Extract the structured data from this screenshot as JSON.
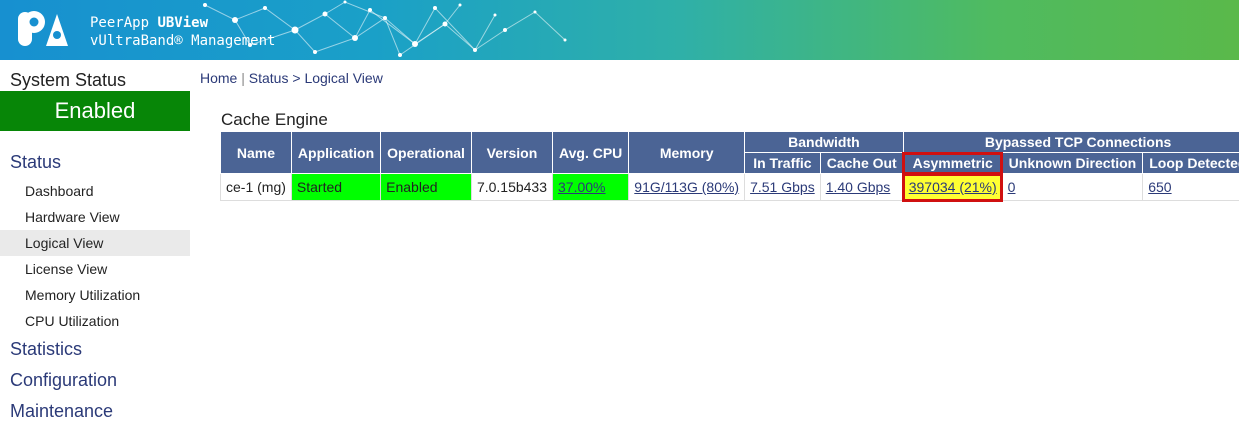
{
  "header": {
    "brand_line1_prefix": "PeerApp ",
    "brand_line1_bold": "UBView",
    "brand_line2": "vUltraBand® Management"
  },
  "sidebar": {
    "system_status_title": "System Status",
    "system_status_value": "Enabled",
    "status_heading": "Status",
    "status_items": [
      "Dashboard",
      "Hardware View",
      "Logical View",
      "License View",
      "Memory Utilization",
      "CPU Utilization"
    ],
    "active_item": "Logical View",
    "statistics": "Statistics",
    "configuration": "Configuration",
    "maintenance": "Maintenance"
  },
  "breadcrumb": {
    "home": "Home",
    "sep1": " | ",
    "status": "Status",
    "sep2": " > ",
    "current": "Logical View"
  },
  "section": {
    "title": "Cache Engine"
  },
  "table": {
    "headers": {
      "name": "Name",
      "application": "Application",
      "operational": "Operational",
      "version": "Version",
      "avg_cpu": "Avg. CPU",
      "memory": "Memory",
      "bandwidth": "Bandwidth",
      "in_traffic": "In Traffic",
      "cache_out": "Cache Out",
      "bypassed": "Bypassed TCP Connections",
      "asymmetric": "Asymmetric",
      "unknown_direction": "Unknown Direction",
      "loop_detected": "Loop Detected"
    },
    "row": {
      "name": "ce-1 (mg)",
      "application": "Started",
      "operational": "Enabled",
      "version": "7.0.15b433",
      "avg_cpu": "37.00%",
      "memory": "91G/113G (80%)",
      "in_traffic": "7.51 Gbps",
      "cache_out": "1.40 Gbps",
      "asymmetric": "397034 (21%)",
      "unknown_direction": "0",
      "loop_detected": "650"
    }
  },
  "colors": {
    "nav_link": "#2b3a78",
    "status_green": "#078607",
    "cell_green": "#00ff00",
    "cell_yellow": "#ffff33",
    "highlight_red": "#d01010",
    "table_header": "#4b6495"
  }
}
